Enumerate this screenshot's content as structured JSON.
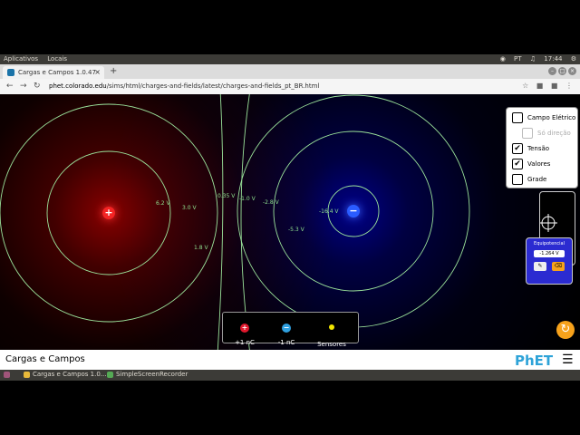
{
  "system_bar": {
    "apps_label": "Aplicativos",
    "places_label": "Locais",
    "clock": "17:44",
    "ptbr_indicator": "PT"
  },
  "browser": {
    "tab_title": "Cargas e Campos 1.0.47",
    "new_tab": "+",
    "url_host": "phet.colorado.edu",
    "url_path": "/sims/html/charges-and-fields/latest/charges-and-fields_pt_BR.html"
  },
  "sim": {
    "positive_charge_symbol": "+",
    "negative_charge_symbol": "−",
    "voltage_labels": [
      "6.2 V",
      "3.0 V",
      "1.8 V",
      "0.35 V",
      "-1.0 V",
      "-2.8 V",
      "-5.3 V",
      "-16.4 V"
    ]
  },
  "control_panel": {
    "items": [
      {
        "label": "Campo Elétrico",
        "checked": false,
        "mark": "",
        "disabled": false
      },
      {
        "label": "Só direção",
        "checked": false,
        "mark": "",
        "disabled": true
      },
      {
        "label": "Tensão",
        "checked": true,
        "mark": "✔",
        "disabled": false
      },
      {
        "label": "Valores",
        "checked": true,
        "mark": "✔",
        "disabled": false
      },
      {
        "label": "Grade",
        "checked": false,
        "mark": "",
        "disabled": false
      }
    ]
  },
  "equipotential_tool": {
    "title": "Equipotencial",
    "value": "-1.264 V"
  },
  "charge_tray": {
    "items": [
      {
        "label": "+1 nC",
        "symbol": "+",
        "color": "#e0182d"
      },
      {
        "label": "-1 nC",
        "symbol": "−",
        "color": "#2fa0e0"
      },
      {
        "label": "Sensores",
        "symbol": "",
        "color": "#f2e600"
      }
    ]
  },
  "navbar": {
    "title": "Cargas e Campos",
    "logo": "PhET"
  },
  "taskbar": {
    "items": [
      "Cargas e Campos 1.0...",
      "SimpleScreenRecorder"
    ]
  },
  "colors": {
    "positive": "#ff2020",
    "negative": "#2020ff",
    "equipotential_line": "#9be39b",
    "reset": "#f7a21b"
  }
}
